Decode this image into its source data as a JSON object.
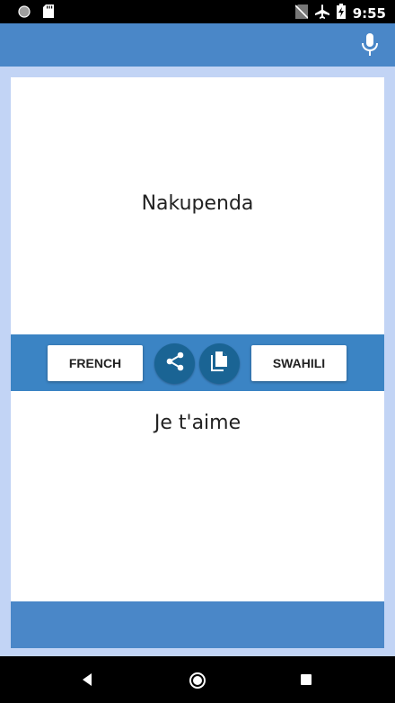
{
  "status_bar": {
    "time": "9:55",
    "icons": [
      "recording-dot-icon",
      "sd-card-icon",
      "no-sim-icon",
      "airplane-mode-icon",
      "battery-charging-icon"
    ]
  },
  "app_bar": {
    "mic_icon": "microphone-icon",
    "color": "#4a87c8"
  },
  "translation": {
    "source_text": "Nakupenda",
    "target_text": "Je t'aime"
  },
  "toolbar": {
    "left_language": "FRENCH",
    "right_language": "SWAHILI",
    "share_icon": "share-icon",
    "copy_icon": "copy-icon",
    "color": "#3b84c4"
  },
  "nav_bar": {
    "icons": [
      "back-icon",
      "home-icon",
      "recents-icon"
    ]
  },
  "colors": {
    "background": "#c2d4f5",
    "app_bar": "#4a87c8",
    "toolbar": "#3b84c4",
    "circle_button": "#1a6494"
  }
}
